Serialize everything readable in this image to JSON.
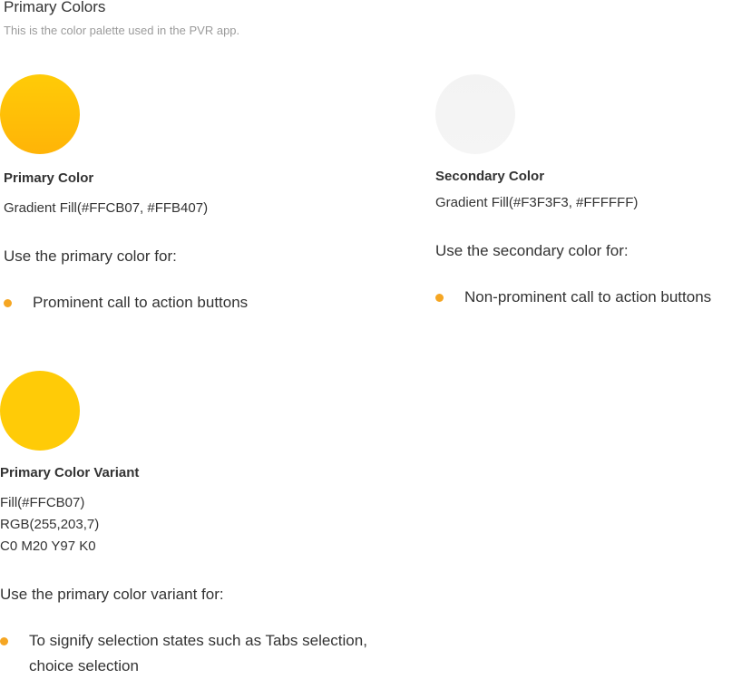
{
  "header": {
    "title": "Primary Colors",
    "subtitle": "This is the color palette used in the PVR app."
  },
  "colors": {
    "primary": {
      "name": "Primary Color",
      "spec": "Gradient Fill(#FFCB07, #FFB407)",
      "usage_heading": "Use the primary color for:",
      "usage_items": [
        "Prominent call to action buttons"
      ],
      "swatch_colors": [
        "#FFCB07",
        "#FFB407"
      ]
    },
    "secondary": {
      "name": "Secondary Color",
      "spec": "Gradient Fill(#F3F3F3, #FFFFFF)",
      "usage_heading": "Use the secondary color for:",
      "usage_items": [
        "Non-prominent call to action buttons"
      ],
      "swatch_colors": [
        "#F3F3F3",
        "#FFFFFF"
      ]
    },
    "variant": {
      "name": "Primary Color Variant",
      "spec_lines": [
        "Fill(#FFCB07)",
        "RGB(255,203,7)",
        "C0 M20 Y97 K0"
      ],
      "usage_heading": "Use the primary color variant for:",
      "usage_items": [
        "To signify selection states such as Tabs selection, choice selection"
      ],
      "swatch_colors": [
        "#FFCB07"
      ]
    }
  },
  "accent": {
    "bullet_color": "#F5A623"
  }
}
